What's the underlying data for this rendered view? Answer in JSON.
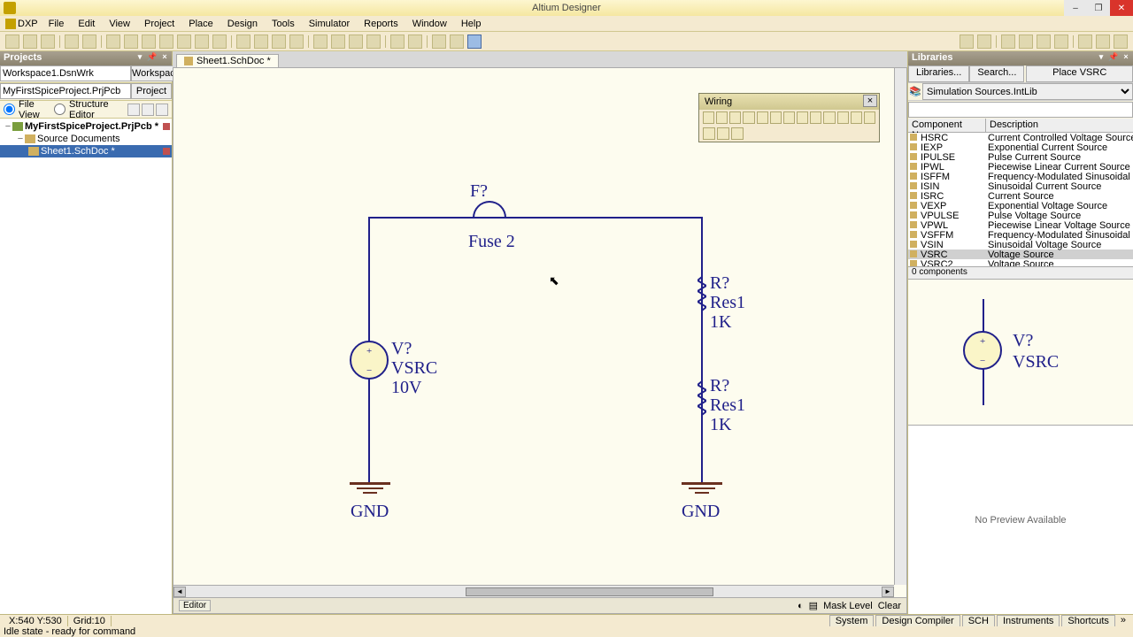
{
  "app": {
    "title": "Altium Designer"
  },
  "menu": [
    "DXP",
    "File",
    "Edit",
    "View",
    "Project",
    "Place",
    "Design",
    "Tools",
    "Simulator",
    "Reports",
    "Window",
    "Help"
  ],
  "projects": {
    "panel_title": "Projects",
    "workspace": "Workspace1.DsnWrk",
    "workspace_btn": "Workspace",
    "project": "MyFirstSpiceProject.PrjPcb",
    "project_btn": "Project",
    "view_file": "File View",
    "view_struct": "Structure Editor",
    "tree": {
      "root": "MyFirstSpiceProject.PrjPcb *",
      "src": "Source Documents",
      "doc": "Sheet1.SchDoc *"
    }
  },
  "tab": {
    "label": "Sheet1.SchDoc *"
  },
  "wiring": {
    "title": "Wiring"
  },
  "schematic": {
    "fuse": {
      "designator": "F?",
      "value": "Fuse 2"
    },
    "vsrc": {
      "designator": "V?",
      "comment": "VSRC",
      "value": "10V"
    },
    "r1": {
      "designator": "R?",
      "comment": "Res1",
      "value": "1K"
    },
    "r2": {
      "designator": "R?",
      "comment": "Res1",
      "value": "1K"
    },
    "gnd": "GND"
  },
  "libraries": {
    "panel_title": "Libraries",
    "btn_lib": "Libraries...",
    "btn_search": "Search...",
    "btn_place": "Place VSRC",
    "selected_lib": "Simulation Sources.IntLib",
    "col_name": "Component Name",
    "col_desc": "Description",
    "components": [
      {
        "name": "HSRC",
        "desc": "Current Controlled Voltage Source"
      },
      {
        "name": "IEXP",
        "desc": "Exponential Current Source"
      },
      {
        "name": "IPULSE",
        "desc": "Pulse Current Source"
      },
      {
        "name": "IPWL",
        "desc": "Piecewise Linear Current Source"
      },
      {
        "name": "ISFFM",
        "desc": "Frequency-Modulated Sinusoidal Curren"
      },
      {
        "name": "ISIN",
        "desc": "Sinusoidal Current Source"
      },
      {
        "name": "ISRC",
        "desc": "Current Source"
      },
      {
        "name": "VEXP",
        "desc": "Exponential Voltage Source"
      },
      {
        "name": "VPULSE",
        "desc": "Pulse Voltage Source"
      },
      {
        "name": "VPWL",
        "desc": "Piecewise Linear Voltage Source"
      },
      {
        "name": "VSFFM",
        "desc": "Frequency-Modulated Sinusoidal Voltag"
      },
      {
        "name": "VSIN",
        "desc": "Sinusoidal Voltage Source"
      },
      {
        "name": "VSRC",
        "desc": "Voltage Source",
        "sel": true
      },
      {
        "name": "VSRC2",
        "desc": "Voltage Source"
      }
    ],
    "count": "0 components",
    "preview": {
      "designator": "V?",
      "comment": "VSRC"
    },
    "no_preview": "No Preview Available"
  },
  "editor_footer": {
    "tab": "Editor",
    "mask": "Mask Level",
    "clear": "Clear"
  },
  "status": {
    "coords": "X:540 Y:530",
    "grid": "Grid:10",
    "idle": "Idle state - ready for command",
    "tabs": [
      "System",
      "Design Compiler",
      "SCH",
      "Instruments",
      "Shortcuts"
    ]
  }
}
